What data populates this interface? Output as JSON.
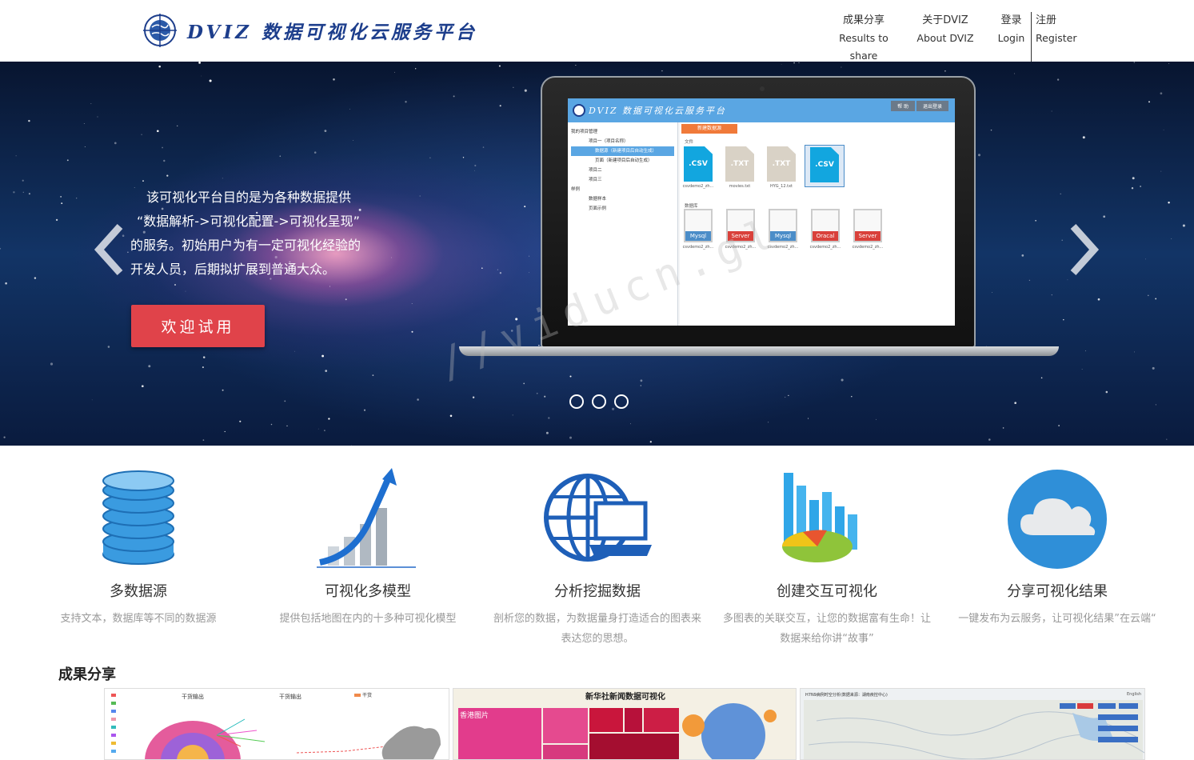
{
  "header": {
    "logo_text": "DVIZ 数据可视化云服务平台",
    "nav": {
      "results_cn": "成果分享",
      "results_en": "Results to share",
      "about_cn": "关于DVIZ",
      "about_en": "About DVIZ",
      "login_cn": "登录",
      "login_en": "Login",
      "register_cn": "注册",
      "register_en": "Register"
    }
  },
  "banner": {
    "intro_lines": [
      "该可视化平台目的是为各种数据提供",
      "“数据解析->可视化配置->可视化呈现”",
      "的服务。初始用户为有一定可视化经验的",
      "开发人员，后期拟扩展到普通大众。"
    ],
    "cta_label": "欢迎试用",
    "slides_count": 3,
    "laptop": {
      "title": "DVIZ 数据可视化云服务平台",
      "buttons": [
        "帮 助",
        "退出登录"
      ],
      "new_btn": "新建数据源",
      "tree": [
        "我的项目管理",
        "项目一（项目名称）",
        "数据源（新建项目后自动生成）",
        "页面（新建项目后自动生成）",
        "项目二",
        "项目三",
        "样例",
        "数据样本",
        "页面示例"
      ],
      "file_section": "文件",
      "db_section": "数据库",
      "files": [
        {
          "type": ".CSV",
          "name": "csvdemo2_zh..."
        },
        {
          "type": ".TXT",
          "name": "movies.txt"
        },
        {
          "type": ".TXT",
          "name": "HYG_12.txt"
        },
        {
          "type": ".CSV",
          "name": ""
        }
      ],
      "dbs": [
        {
          "type": "Mysql",
          "name": "csvdemo2_zh..."
        },
        {
          "type": "Server",
          "name": "csvdemo2_zh..."
        },
        {
          "type": "Mysql",
          "name": "csvdemo2_zh..."
        },
        {
          "type": "Oracal",
          "name": "csvdemo2_zh..."
        },
        {
          "type": "Server",
          "name": "csvdemo2_zh..."
        }
      ]
    }
  },
  "features": [
    {
      "title": "多数据源",
      "desc": "支持文本，数据库等不同的数据源"
    },
    {
      "title": "可视化多模型",
      "desc": "提供包括地图在内的十多种可视化模型"
    },
    {
      "title": "分析挖掘数据",
      "desc": "剖析您的数据，为数据量身打造适合的图表来表达您的思想。"
    },
    {
      "title": "创建交互可视化",
      "desc": "多图表的关联交互，让您的数据富有生命！让数据来给你讲“故事”"
    },
    {
      "title": "分享可视化结果",
      "desc": "一键发布为云服务，让可视化结果”在云端“"
    }
  ],
  "share": {
    "title": "成果分享",
    "cards": [
      {
        "labels": [
          "干货输出",
          "干货输出",
          "干货"
        ]
      },
      {
        "title": "新华社新闻数据可视化",
        "tile": "香港图片"
      },
      {
        "title": "H7N9病例时空分析(数据来源：湖南疾控中心)",
        "lang": "English"
      }
    ]
  },
  "watermark": "//viducn.gl"
}
